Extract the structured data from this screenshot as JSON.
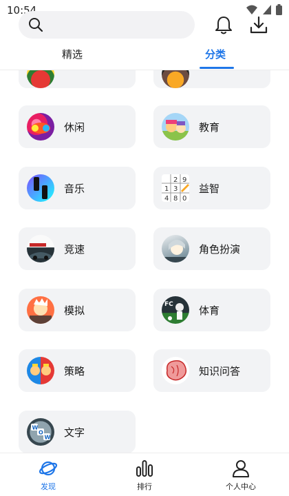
{
  "status_bar": {
    "time": "10:54"
  },
  "header": {
    "search_placeholder": ""
  },
  "tabs": [
    {
      "label": "精选",
      "active": false
    },
    {
      "label": "分类",
      "active": true
    }
  ],
  "categories": [
    {
      "label": "休闲",
      "icon": "candy-game-icon"
    },
    {
      "label": "教育",
      "icon": "toca-world-icon"
    },
    {
      "label": "音乐",
      "icon": "piano-tiles-icon"
    },
    {
      "label": "益智",
      "icon": "sudoku-icon"
    },
    {
      "label": "竞速",
      "icon": "asphalt-9-icon"
    },
    {
      "label": "角色扮演",
      "icon": "anime-rpg-icon"
    },
    {
      "label": "模拟",
      "icon": "cooking-game-icon"
    },
    {
      "label": "体育",
      "icon": "ea-fc-soccer-icon"
    },
    {
      "label": "策略",
      "icon": "clash-royale-icon"
    },
    {
      "label": "知识问答",
      "icon": "brain-test-icon"
    },
    {
      "label": "文字",
      "icon": "wow-words-icon"
    }
  ],
  "bottom_nav": [
    {
      "label": "发现",
      "icon": "planet-icon",
      "active": true
    },
    {
      "label": "排行",
      "icon": "bar-chart-icon",
      "active": false
    },
    {
      "label": "个人中心",
      "icon": "person-icon",
      "active": false
    }
  ],
  "colors": {
    "accent": "#1e76e8",
    "card_bg": "#f2f3f5"
  }
}
